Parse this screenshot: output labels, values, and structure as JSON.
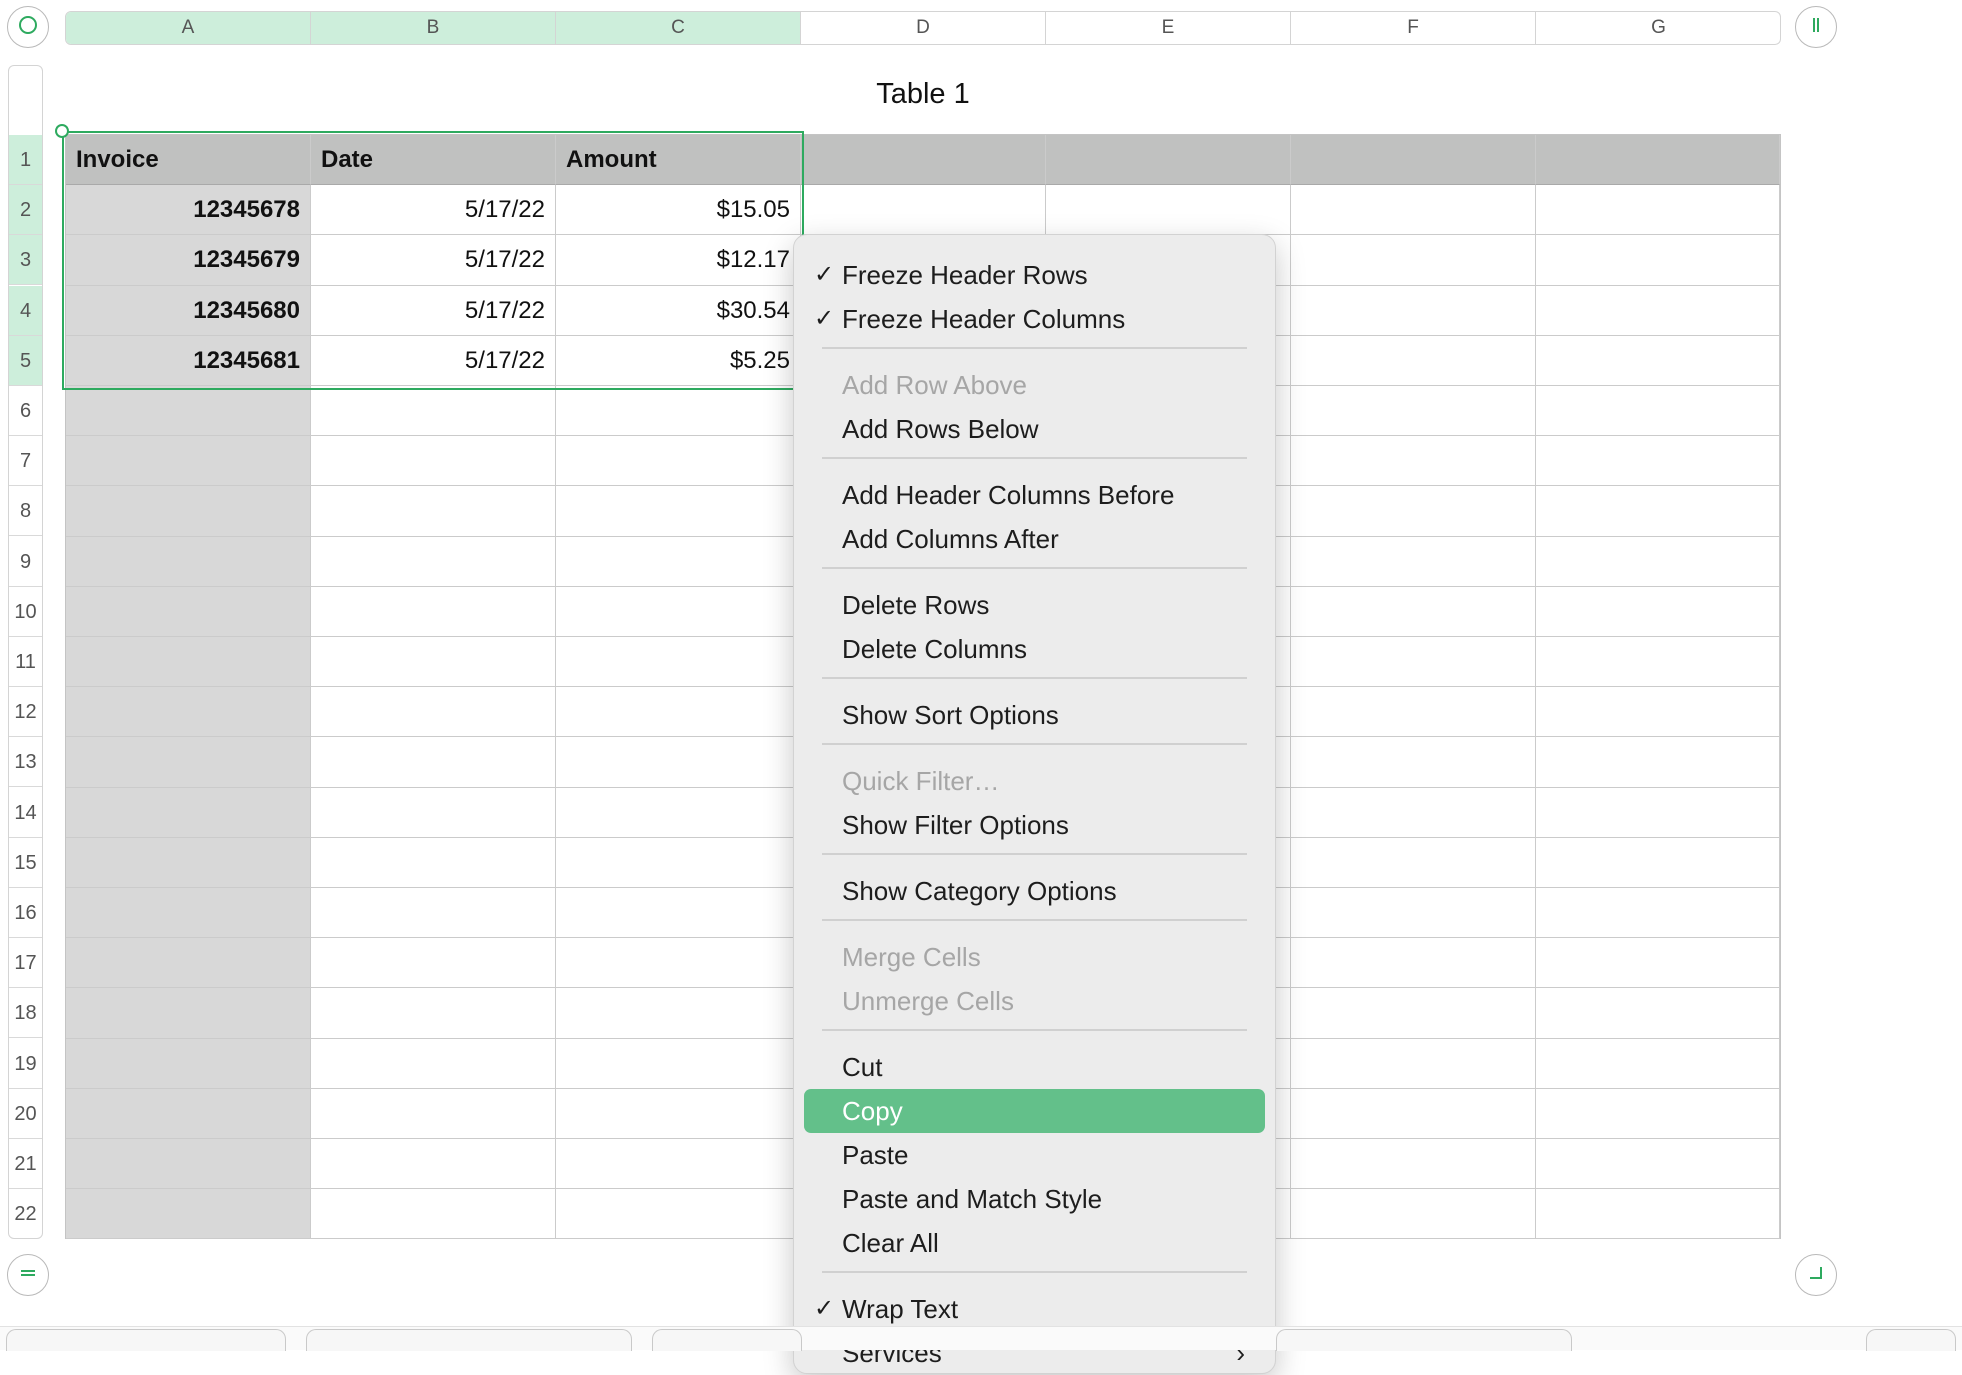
{
  "table": {
    "title": "Table 1",
    "columns": [
      "A",
      "B",
      "C",
      "D",
      "E",
      "F",
      "G"
    ],
    "rows": [
      "1",
      "2",
      "3",
      "4",
      "5",
      "6",
      "7",
      "8",
      "9",
      "10",
      "11",
      "12",
      "13",
      "14",
      "15",
      "16",
      "17",
      "18",
      "19",
      "20",
      "21",
      "22"
    ],
    "header": [
      "Invoice",
      "Date",
      "Amount"
    ],
    "data": [
      [
        "12345678",
        "5/17/22",
        "$15.05"
      ],
      [
        "12345679",
        "5/17/22",
        "$12.17"
      ],
      [
        "12345680",
        "5/17/22",
        "$30.54"
      ],
      [
        "12345681",
        "5/17/22",
        "$5.25"
      ]
    ]
  },
  "context_menu": {
    "items": [
      {
        "label": "Freeze Header Rows",
        "checked": true,
        "disabled": false
      },
      {
        "label": "Freeze Header Columns",
        "checked": true,
        "disabled": false
      },
      {
        "separator": true
      },
      {
        "label": "Add Row Above",
        "disabled": true
      },
      {
        "label": "Add Rows Below",
        "disabled": false
      },
      {
        "separator": true
      },
      {
        "label": "Add Header Columns Before",
        "disabled": false
      },
      {
        "label": "Add Columns After",
        "disabled": false
      },
      {
        "separator": true
      },
      {
        "label": "Delete Rows",
        "disabled": false
      },
      {
        "label": "Delete Columns",
        "disabled": false
      },
      {
        "separator": true
      },
      {
        "label": "Show Sort Options",
        "disabled": false
      },
      {
        "separator": true
      },
      {
        "label": "Quick Filter…",
        "disabled": true
      },
      {
        "label": "Show Filter Options",
        "disabled": false
      },
      {
        "separator": true
      },
      {
        "label": "Show Category Options",
        "disabled": false
      },
      {
        "separator": true
      },
      {
        "label": "Merge Cells",
        "disabled": true
      },
      {
        "label": "Unmerge Cells",
        "disabled": true
      },
      {
        "separator": true
      },
      {
        "label": "Cut",
        "disabled": false
      },
      {
        "label": "Copy",
        "disabled": false,
        "highlighted": true
      },
      {
        "label": "Paste",
        "disabled": false
      },
      {
        "label": "Paste and Match Style",
        "disabled": false
      },
      {
        "label": "Clear All",
        "disabled": false
      },
      {
        "separator": true
      },
      {
        "label": "Wrap Text",
        "checked": true,
        "disabled": false
      },
      {
        "label": "Services",
        "submenu": true,
        "disabled": false
      }
    ]
  },
  "icons": {
    "select_all": "circle-icon",
    "add_column": "column-handle-icon",
    "add_row": "row-handle-icon",
    "resize": "resize-corner-icon",
    "check": "✓",
    "submenu_arrow": "›"
  },
  "colors": {
    "selection": "#2eaa5f",
    "selected_header": "#cdeedb",
    "highlight": "#63c08a",
    "header_row": "#c0c1c0",
    "header_column": "#d8d8d8"
  }
}
